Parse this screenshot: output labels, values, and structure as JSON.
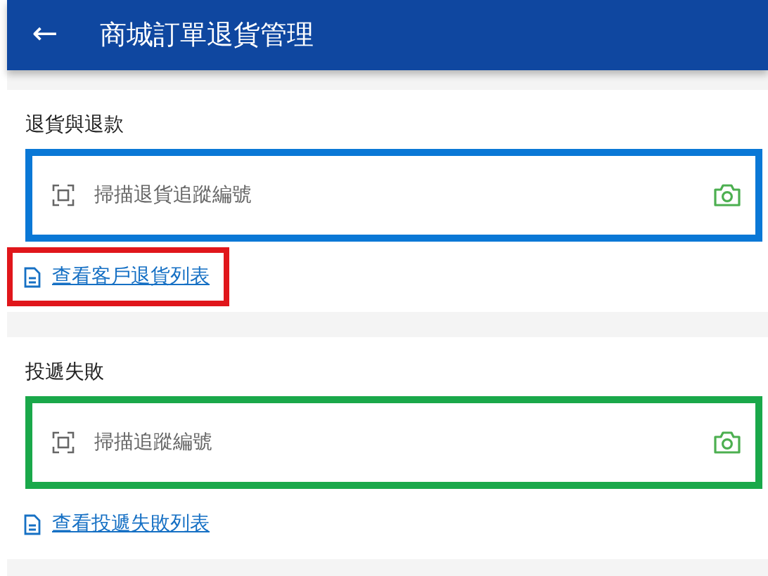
{
  "app_bar": {
    "back_icon": "←",
    "title": "商城訂單退貨管理"
  },
  "sections": [
    {
      "title": "退貨與退款",
      "field": {
        "placeholder": "掃描退貨追蹤編號",
        "color": "#0a78d6"
      },
      "link": {
        "label": "查看客戶退貨列表",
        "highlighted": true
      }
    },
    {
      "title": "投遞失敗",
      "field": {
        "placeholder": "掃描追蹤編號",
        "color": "#1aa84a"
      },
      "link": {
        "label": "查看投遞失敗列表",
        "highlighted": false
      }
    }
  ]
}
